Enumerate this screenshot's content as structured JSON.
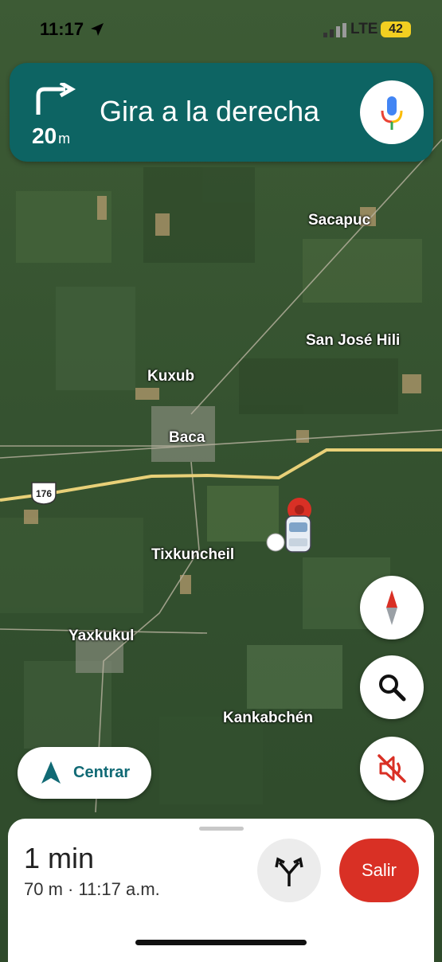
{
  "status_bar": {
    "time": "11:17",
    "network": "LTE",
    "battery": "42"
  },
  "navigation": {
    "distance_value": "20",
    "distance_unit": "m",
    "instruction": "Gira a la derecha"
  },
  "map": {
    "places": {
      "sacapuc": "Sacapuc",
      "san_jose_hili": "San José Hili",
      "kuxub": "Kuxub",
      "baca": "Baca",
      "tixkuncheil": "Tixkuncheil",
      "yaxkukul": "Yaxkukul",
      "kankabchen": "Kankabchén"
    },
    "route_number": "176"
  },
  "controls": {
    "recenter_label": "Centrar"
  },
  "trip": {
    "eta": "1 min",
    "details": "70 m · 11:17 a.m.",
    "exit_label": "Salir"
  },
  "colors": {
    "banner": "#0d6463",
    "exit": "#d93025",
    "accent": "#116a75",
    "battery": "#f2cf21"
  }
}
